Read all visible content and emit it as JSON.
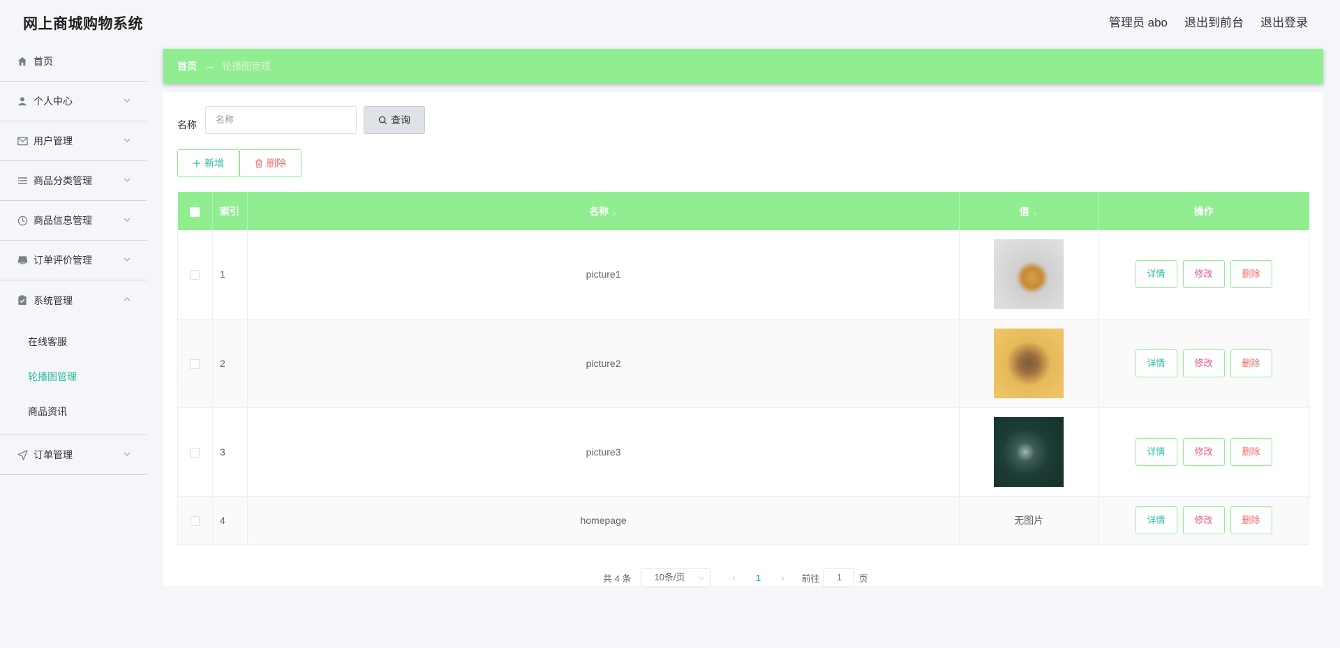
{
  "header": {
    "brand": "网上商城购物系统",
    "user_label": "管理员 abo",
    "to_front": "退出到前台",
    "logout": "退出登录"
  },
  "sidebar": {
    "items": [
      {
        "label": "首页",
        "icon": "home-icon"
      },
      {
        "label": "个人中心",
        "icon": "user-icon"
      },
      {
        "label": "用户管理",
        "icon": "mail-icon"
      },
      {
        "label": "商品分类管理",
        "icon": "list-icon"
      },
      {
        "label": "商品信息管理",
        "icon": "clock-icon"
      },
      {
        "label": "订单评价管理",
        "icon": "printer-icon"
      },
      {
        "label": "系统管理",
        "icon": "clipboard-icon"
      },
      {
        "label": "订单管理",
        "icon": "send-icon"
      }
    ],
    "sub_items": [
      "在线客服",
      "轮播图管理",
      "商品资讯"
    ]
  },
  "breadcrumb": {
    "home": "首页",
    "arrow": "→",
    "current": "轮播图管理"
  },
  "search": {
    "label": "名称",
    "placeholder": "名称",
    "button": "查询"
  },
  "actions": {
    "add": "新增",
    "delete": "删除"
  },
  "table": {
    "columns": [
      "索引",
      "名称",
      "值",
      "操作"
    ],
    "rows": [
      {
        "index": "1",
        "name": "picture1",
        "value": "",
        "image": "thumb1"
      },
      {
        "index": "2",
        "name": "picture2",
        "value": "",
        "image": "thumb2"
      },
      {
        "index": "3",
        "name": "picture3",
        "value": "",
        "image": "thumb3"
      },
      {
        "index": "4",
        "name": "homepage",
        "value": "无图片",
        "image": ""
      }
    ],
    "ops": {
      "detail": "详情",
      "edit": "修改",
      "delete": "删除"
    }
  },
  "pagination": {
    "total": "共 4 条",
    "page_size": "10条/页",
    "current": "1",
    "goto_label": "前往",
    "goto_value": "1",
    "page_suffix": "页"
  },
  "colors": {
    "accent_green": "#90ee90",
    "text_teal": "#2fbfa0",
    "danger": "#f56c6c",
    "edit_pink": "#f0508c"
  }
}
